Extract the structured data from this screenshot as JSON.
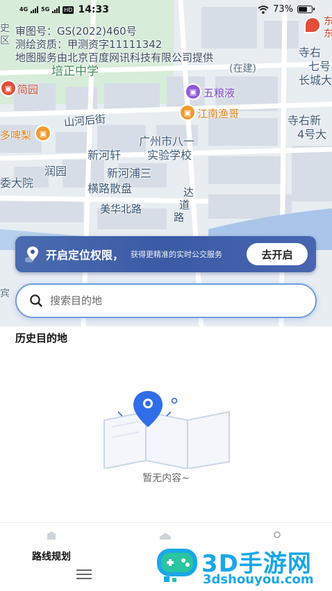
{
  "status_bar": {
    "network_left": "4G",
    "network_right": "5G",
    "hd_badge": "HD",
    "time": "14:33",
    "battery_percent_text": "73%",
    "battery_level": 0.73
  },
  "map": {
    "copyright_lines": [
      "审图号：GS(2022)460号",
      "测绘资质：甲测资字11111342",
      "地图服务由北京百度网讯科技有限公司提供"
    ],
    "labels": {
      "peizheng": "培正中学",
      "jiangeyuan": "简园",
      "wuliangye": "五粮液",
      "jiangnan": "江南渔哥",
      "shanhe": "山河后街",
      "duobeili": "多啤梨",
      "xinhexuan": "新河轩",
      "school_top": "广州市八一",
      "school_bottom": "实验学校",
      "runyuan": "润园",
      "xinhepu": "新河浦三",
      "henglu": "横路散盘",
      "daodao_top": "达",
      "daodao_mid": "道",
      "daodao_bot": "路",
      "meihua": "美华北路",
      "weida": "委大院",
      "siyou_top": "寺右",
      "qihao": "七号",
      "changcheng": "长城大",
      "siyou_xin": "寺右新",
      "sihao": "4号大",
      "zaijian": "(在建)",
      "dong1": "东",
      "dong2": "东",
      "shiqu": "史",
      "qu": "区",
      "bin": "宾"
    }
  },
  "banner": {
    "title": "开启定位权限，",
    "subtitle": "获得更精准的实时公交服务",
    "button": "去开启"
  },
  "search": {
    "placeholder": "搜索目的地",
    "value": ""
  },
  "history": {
    "title": "历史目的地",
    "empty_text": "暂无内容~"
  },
  "tabbar": {
    "tabs": [
      {
        "label": "路线规划"
      }
    ]
  },
  "watermark": {
    "cn": "3D手游网",
    "en": "3dshouyou.com"
  },
  "colors": {
    "accent": "#3b5aa5",
    "search_border": "#6f9ce0",
    "map_bg": "#e8edf2",
    "watermark": "#1aa7e8"
  }
}
